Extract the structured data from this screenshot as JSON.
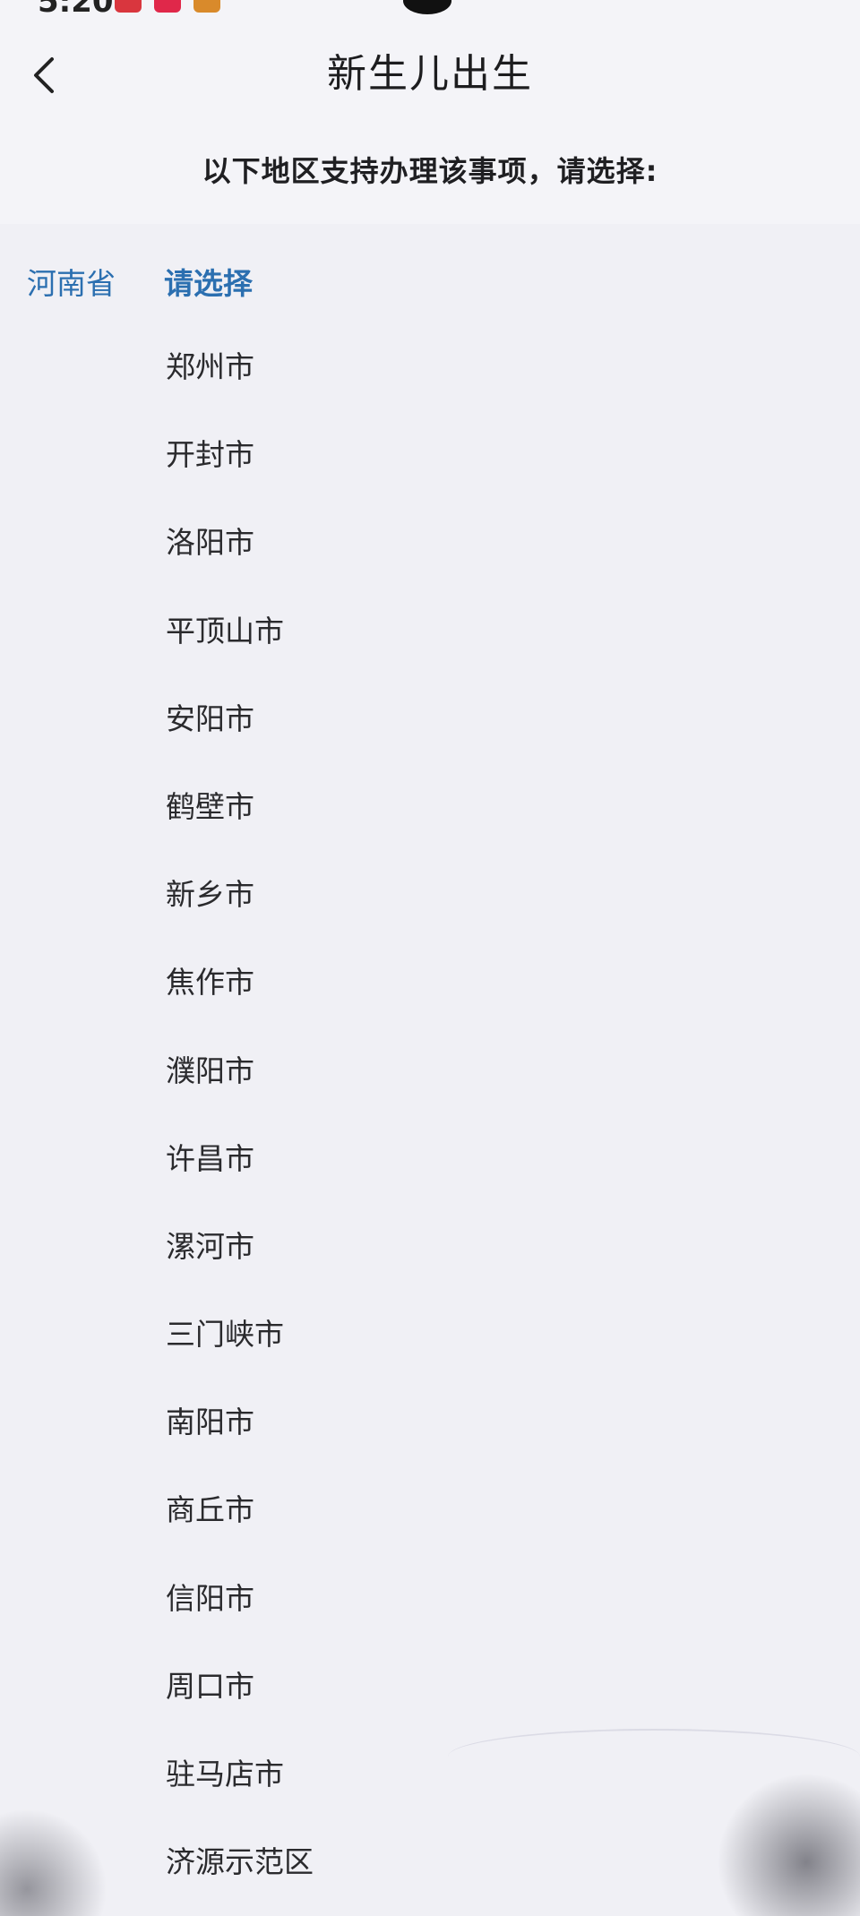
{
  "status_bar": {
    "time": "5:20",
    "app_icon_colors": [
      "#d9363e",
      "#e0284a",
      "#d98a2b"
    ]
  },
  "header": {
    "back_icon": "chevron-left-icon",
    "title": "新生儿出生",
    "subtitle": "以下地区支持办理该事项，请选择:"
  },
  "region_picker": {
    "province": "河南省",
    "city_prompt": "请选择",
    "cities": [
      "郑州市",
      "开封市",
      "洛阳市",
      "平顶山市",
      "安阳市",
      "鹤壁市",
      "新乡市",
      "焦作市",
      "濮阳市",
      "许昌市",
      "漯河市",
      "三门峡市",
      "南阳市",
      "商丘市",
      "信阳市",
      "周口市",
      "驻马店市",
      "济源示范区"
    ]
  },
  "colors": {
    "accent": "#2b6fb0",
    "background": "#f0f0f5",
    "text": "#2a2a2d"
  }
}
